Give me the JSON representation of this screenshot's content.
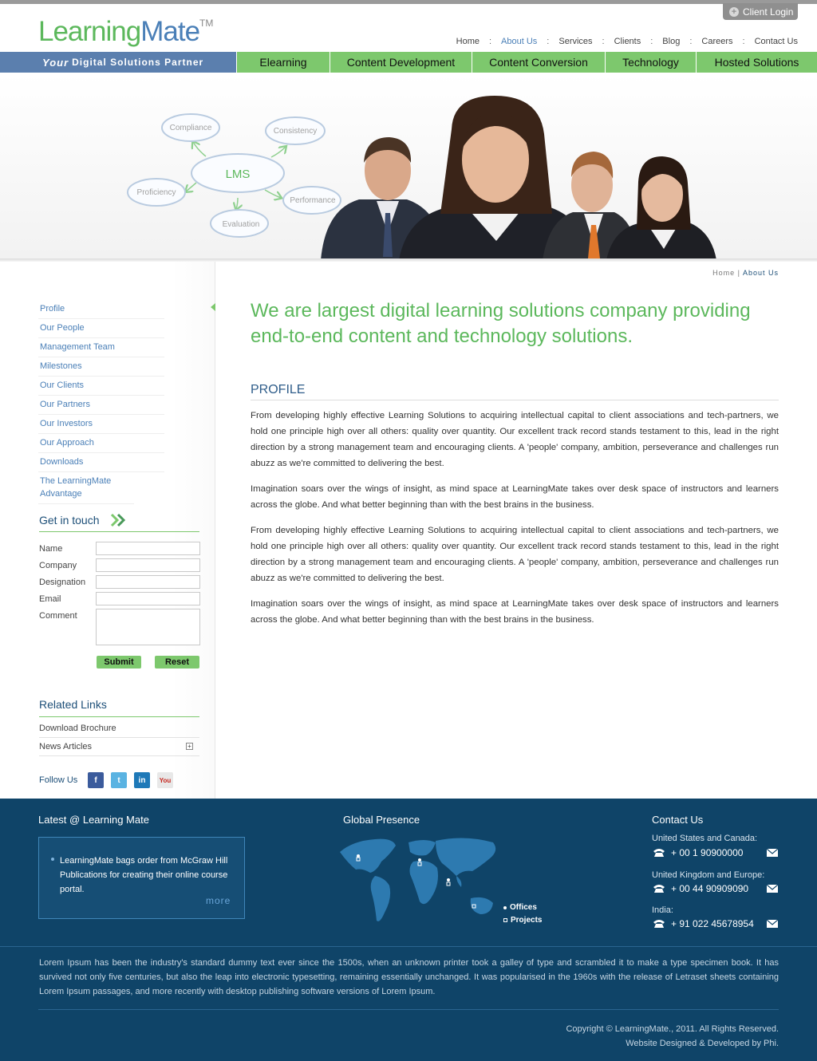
{
  "header": {
    "client_login": "Client Login",
    "logo_learning": "Learning",
    "logo_mate": "Mate",
    "logo_tm": "TM",
    "nav": [
      "Home",
      "About Us",
      "Services",
      "Clients",
      "Blog",
      "Careers",
      "Contact Us"
    ],
    "nav_active": "About Us",
    "tagline_your": "Your",
    "tagline_rest": "Digital Solutions Partner",
    "main_nav": [
      "Elearning",
      "Content Development",
      "Content Conversion",
      "Technology",
      "Hosted Solutions"
    ]
  },
  "banner": {
    "center": "LMS",
    "bubbles": [
      "Compliance",
      "Consistency",
      "Proficiency",
      "Performance",
      "Evaluation"
    ]
  },
  "breadcrumb": {
    "home": "Home",
    "sep": "|",
    "current": "About Us"
  },
  "sidebar": {
    "menu": [
      "Profile",
      "Our People",
      "Management Team",
      "Milestones",
      "Our Clients",
      "Our Partners",
      "Our Investors",
      "Our Approach",
      "Downloads",
      "The LearningMate Advantage"
    ],
    "get_in_touch": {
      "title": "Get in touch",
      "labels": [
        "Name",
        "Company",
        "Designation",
        "Email",
        "Comment"
      ],
      "submit": "Submit",
      "reset": "Reset"
    },
    "related_links": {
      "title": "Related Links",
      "items": [
        "Download Brochure",
        "News Articles"
      ]
    },
    "follow_us": "Follow Us"
  },
  "main": {
    "headline": "We are largest digital learning solutions company providing end-to-end content and technology solutions.",
    "section_title": "PROFILE",
    "paragraphs": [
      "From developing highly effective Learning Solutions to acquiring intellectual capital to client associations and tech-partners, we hold one principle high over all others: quality over quantity. Our excellent track record stands testament to this, lead in the right direction by a strong management team and encouraging clients. A 'people' company, ambition, perseverance and challenges run abuzz as we're committed to delivering the best.",
      "Imagination soars over the wings of insight, as mind space at LearningMate takes over desk space of instructors and learners across the globe. And what better beginning than with the best brains in the business.",
      "From developing highly effective Learning Solutions to acquiring intellectual capital to client associations and tech-partners, we hold one principle high over all others: quality over quantity. Our excellent track record stands testament to this, lead in the right direction by a strong management team and encouraging clients. A 'people' company, ambition, perseverance and challenges run abuzz as we're committed to delivering the best.",
      "Imagination soars over the wings of insight, as mind space at LearningMate takes over desk space of instructors and learners across the globe. And what better beginning than with the best brains in the business."
    ]
  },
  "footer": {
    "latest_title": "Latest @ Learning Mate",
    "news": "LearningMate bags order from McGraw Hill Publications for creating their online course portal.",
    "more": "more",
    "global_title": "Global Presence",
    "legend": [
      "Offices",
      "Projects"
    ],
    "contact_title": "Contact Us",
    "contacts": [
      {
        "region": "United States and Canada:",
        "phone": "+ 00 1 90900000"
      },
      {
        "region": "United Kingdom and Europe:",
        "phone": "+ 00 44  90909090"
      },
      {
        "region": "India:",
        "phone": "+ 91 022  45678954"
      }
    ],
    "lorem": "Lorem Ipsum has been the industry's standard dummy text ever since the 1500s, when an unknown printer took a galley of type and scrambled it to make a type specimen book. It has survived not only five centuries, but also the leap into electronic typesetting, remaining essentially unchanged. It was popularised in the 1960s with the release of Letraset sheets containing Lorem Ipsum passages, and more recently with desktop publishing software versions of Lorem Ipsum.",
    "copyright": "Copyright © LearningMate., 2011.  All Rights Reserved.",
    "designed_by": "Website Designed & Developed by Phi."
  },
  "colors": {
    "brand_green": "#7dc86d",
    "brand_blue": "#4a7fb7",
    "footer_bg": "#0f4468"
  }
}
